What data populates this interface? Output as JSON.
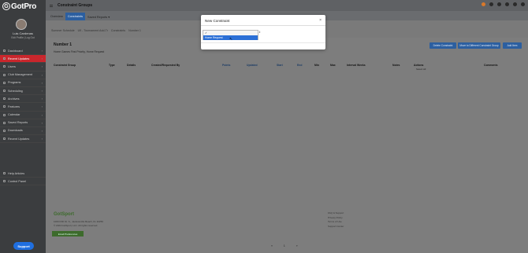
{
  "app": {
    "logo_glyph": "G",
    "logo_text": "GotPro",
    "page_title": "Constraint Groups"
  },
  "user": {
    "name": "Luis Cardenas",
    "links": "Edit Profile  |  Log Out"
  },
  "sidebar": {
    "items": [
      {
        "label": "Dashboard"
      },
      {
        "label": "Recent Updates"
      },
      {
        "label": "Users"
      },
      {
        "label": "Club Management"
      },
      {
        "label": "Programs"
      },
      {
        "label": "Scheduling"
      },
      {
        "label": "Archives"
      },
      {
        "label": "Features"
      },
      {
        "label": "Calendar"
      },
      {
        "label": "Saved Reports"
      },
      {
        "label": "Downloads"
      },
      {
        "label": "Recent Updates"
      }
    ],
    "secondary": [
      {
        "label": "Help Articles"
      },
      {
        "label": "Control Panel"
      }
    ],
    "support_label": "Support"
  },
  "tabs": [
    {
      "label": "Overview"
    },
    {
      "label": "Constraints"
    },
    {
      "label": "Saved Reports ▾"
    }
  ],
  "breadcrumb": [
    "Summer Schedule",
    "U9 - Tournament Add-Tr",
    "Constraints",
    "Number 1"
  ],
  "panel": {
    "heading": "Number 1",
    "subheading": "Home Games First Priority, Home Request",
    "buttons": [
      {
        "label": "Delete Constraint"
      },
      {
        "label": "Move to Different Constraint Group"
      },
      {
        "label": "Add Item"
      }
    ],
    "columns": [
      "Constraint Group",
      "Type",
      "Details",
      "Created/Requested By",
      "Points",
      "Updated",
      "Start",
      "End",
      "Min",
      "Max",
      "Interval Weeks",
      "Notes",
      "Actions",
      "Comments"
    ],
    "select_all": "Select All"
  },
  "footer": {
    "logo": "GotSport",
    "address_1": "1000 Fifth St. S., Jacksonville Beach, FL 32250",
    "address_2": "© 2024 GotSport, LLC. All rights reserved.",
    "button": "Email Preferences",
    "links": [
      "FAQ & Support",
      "Privacy Policy",
      "Terms of Use",
      "Support Center"
    ]
  },
  "pagination": [
    "«",
    "1",
    "»"
  ],
  "modal": {
    "title": "New Constraint",
    "close": "×",
    "options": [
      {
        "label": "✓",
        "selected": false
      },
      {
        "label": "Home Request",
        "selected": true
      }
    ],
    "arrow": "⇕",
    "cursor": "↖"
  }
}
